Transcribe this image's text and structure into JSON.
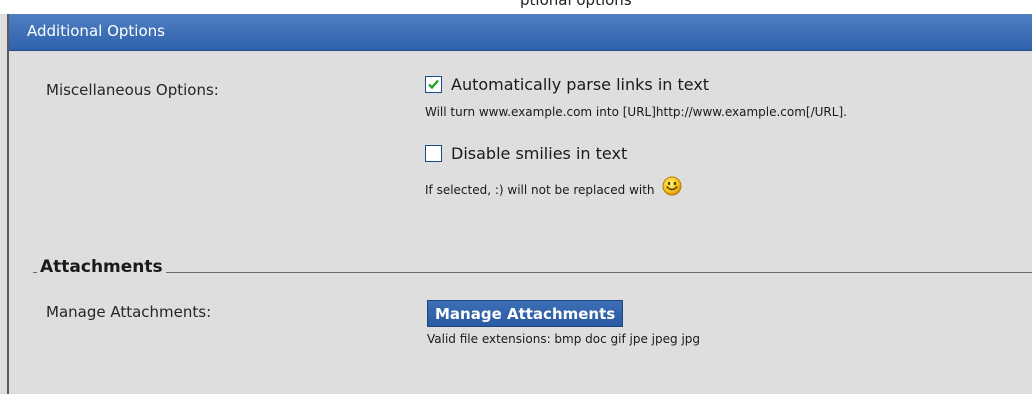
{
  "top_strip": {
    "text": "ptional options"
  },
  "header": {
    "title": "Additional Options"
  },
  "misc": {
    "label": "Miscellaneous Options:",
    "options": [
      {
        "label": "Automatically parse links in text",
        "checked": true,
        "hint": "Will turn www.example.com into [URL]http://www.example.com[/URL]."
      },
      {
        "label": "Disable smilies in text",
        "checked": false,
        "hint": "If selected, :) will not be replaced with"
      }
    ],
    "smiley_icon": "smiley-face-icon"
  },
  "attachments": {
    "section_title": "Attachments",
    "label": "Manage Attachments:",
    "button_label": "Manage Attachments",
    "valid_extensions": "Valid file extensions: bmp doc gif jpe jpeg jpg"
  },
  "colors": {
    "header_blue": "#3a6db5",
    "panel_bg": "#dedede",
    "button_blue": "#2f62ad"
  }
}
